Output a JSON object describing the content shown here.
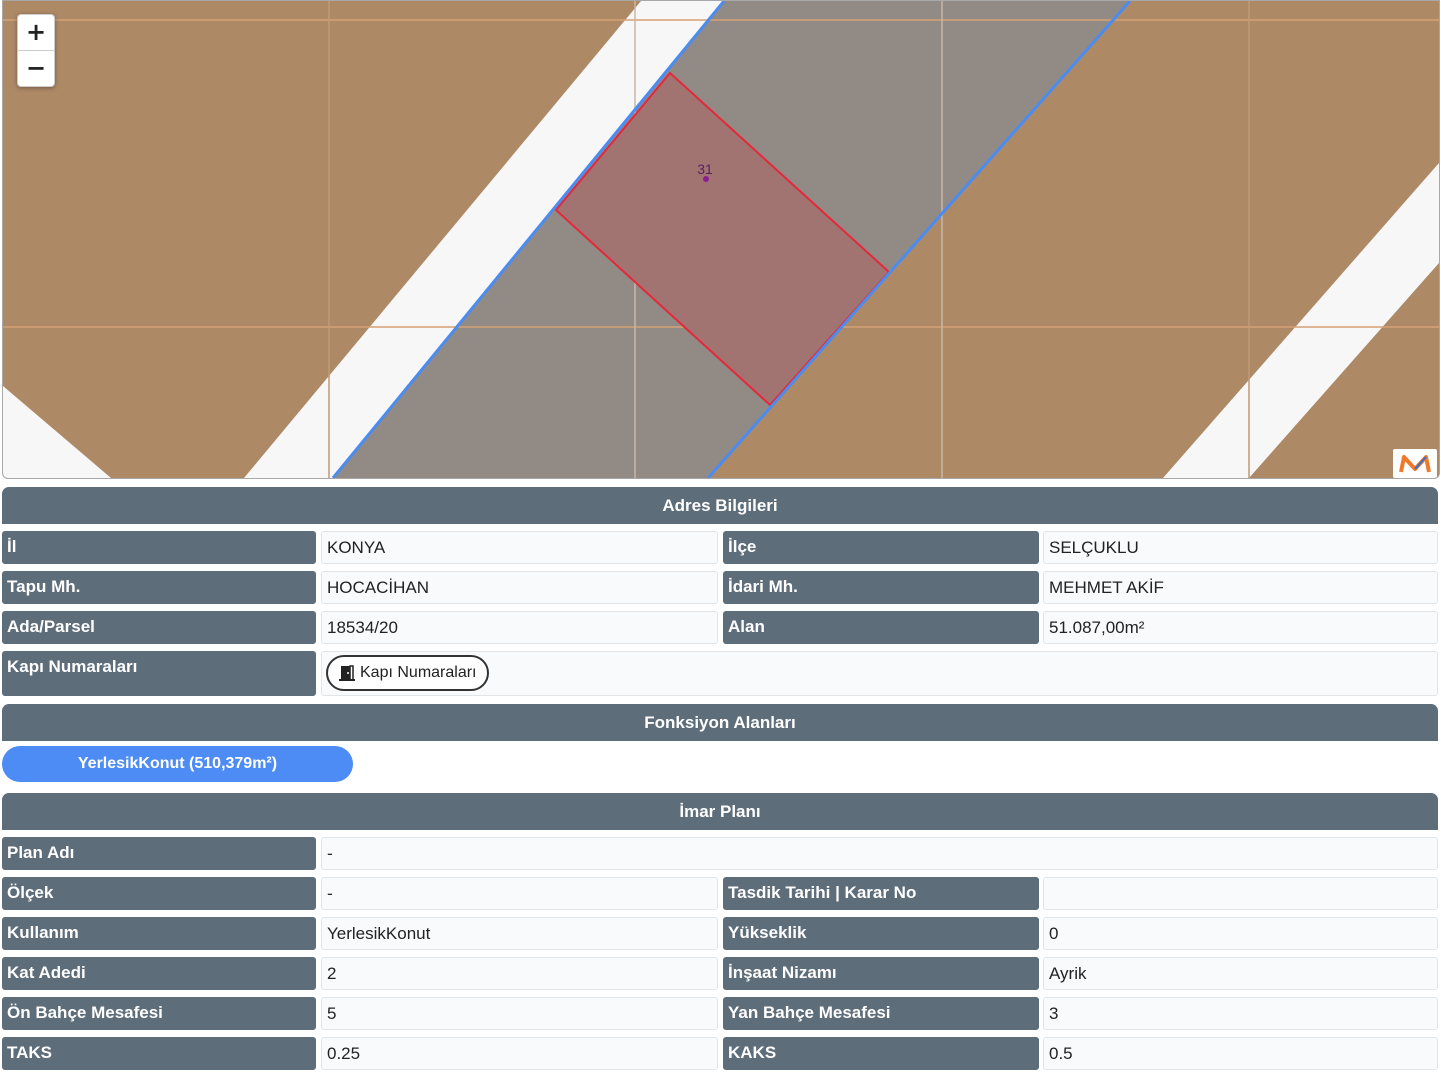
{
  "map": {
    "zoom_in": "+",
    "zoom_out": "−",
    "parcel_number": "31",
    "colors": {
      "background": "#ad8966",
      "road": "#f7f7f7",
      "gray_zone": "#928a85",
      "parcel_fill": "#a17472",
      "parcel_border": "#e5283a",
      "blue_line": "#4a8cf0",
      "grid_line": "#d5a176"
    }
  },
  "address": {
    "header": "Adres Bilgileri",
    "il_label": "İl",
    "il_value": "KONYA",
    "ilce_label": "İlçe",
    "ilce_value": "SELÇUKLU",
    "tapu_label": "Tapu Mh.",
    "tapu_value": "HOCACİHAN",
    "idari_label": "İdari Mh.",
    "idari_value": "MEHMET AKİF",
    "ada_label": "Ada/Parsel",
    "ada_value": "18534/20",
    "alan_label": "Alan",
    "alan_value": "51.087,00m²",
    "kapi_label": "Kapı Numaraları",
    "kapi_button": "Kapı Numaraları"
  },
  "functions": {
    "header": "Fonksiyon Alanları",
    "chip": "YerlesikKonut (510,379m²)"
  },
  "zoning": {
    "header": "İmar Planı",
    "plan_adi_label": "Plan Adı",
    "plan_adi_value": "-",
    "olcek_label": "Ölçek",
    "olcek_value": "-",
    "tasdik_label": "Tasdik Tarihi | Karar No",
    "tasdik_value": "",
    "kullanim_label": "Kullanım",
    "kullanim_value": "YerlesikKonut",
    "yukseklik_label": "Yükseklik",
    "yukseklik_value": "0",
    "kat_label": "Kat Adedi",
    "kat_value": "2",
    "insaat_label": "İnşaat Nizamı",
    "insaat_value": "Ayrik",
    "on_bahce_label": "Ön Bahçe Mesafesi",
    "on_bahce_value": "5",
    "yan_bahce_label": "Yan Bahçe Mesafesi",
    "yan_bahce_value": "3",
    "taks_label": "TAKS",
    "taks_value": "0.25",
    "kaks_label": "KAKS",
    "kaks_value": "0.5"
  }
}
